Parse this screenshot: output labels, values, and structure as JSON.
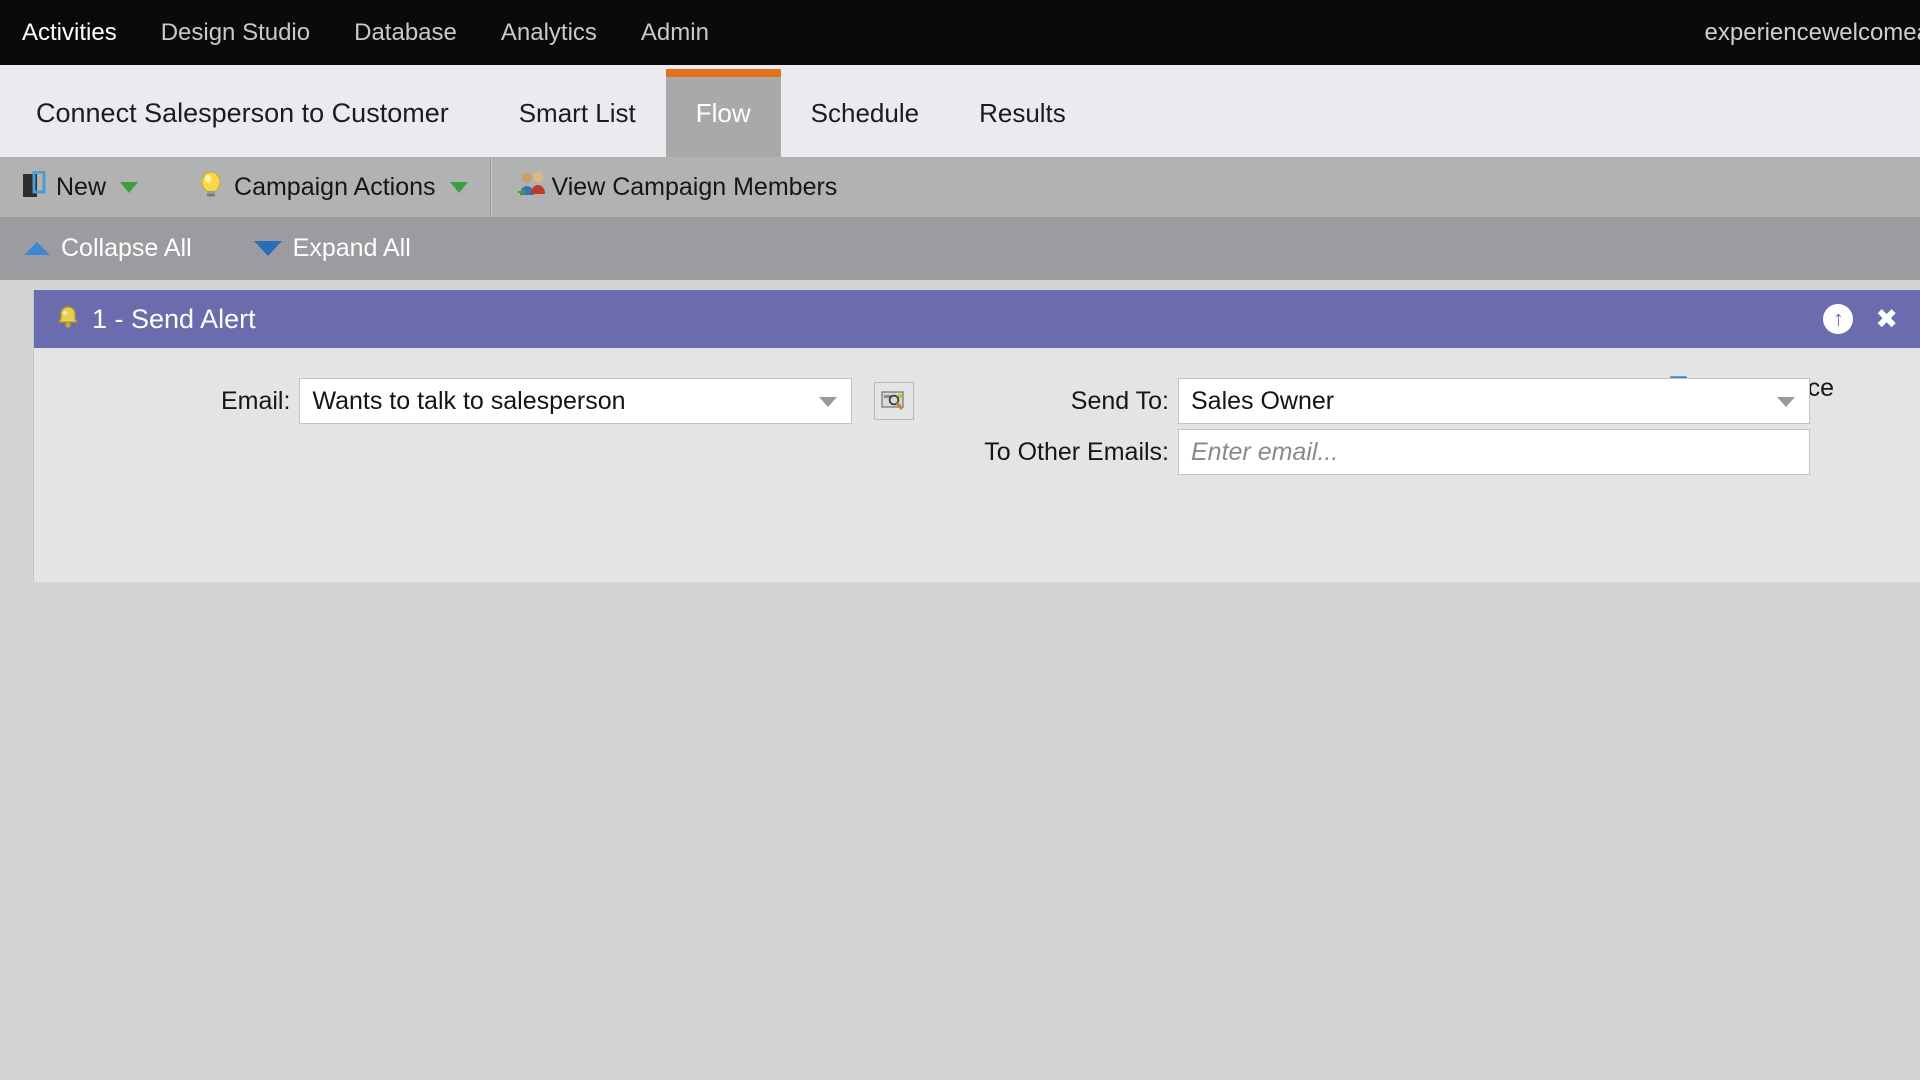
{
  "topnav": {
    "items": [
      {
        "label": "Activities",
        "active": true
      },
      {
        "label": "Design Studio",
        "active": false
      },
      {
        "label": "Database",
        "active": false
      },
      {
        "label": "Analytics",
        "active": false
      },
      {
        "label": "Admin",
        "active": false
      }
    ],
    "user": "experiencewelcomea"
  },
  "tabs": {
    "campaign_title": "Connect Salesperson to Customer",
    "items": [
      {
        "label": "Smart List",
        "active": false
      },
      {
        "label": "Flow",
        "active": true
      },
      {
        "label": "Schedule",
        "active": false
      },
      {
        "label": "Results",
        "active": false
      }
    ],
    "active_accent": "#e3711c"
  },
  "toolbar": {
    "new_label": "New",
    "campaign_actions_label": "Campaign Actions",
    "view_members_label": "View Campaign Members"
  },
  "subtoolbar": {
    "collapse_all": "Collapse All",
    "expand_all": "Expand All"
  },
  "step": {
    "title": "1 - Send Alert",
    "header_color": "#6b6cae",
    "add_choice": "Add Choice",
    "fields": {
      "email_label": "Email:",
      "email_value": "Wants to talk to salesperson",
      "send_to_label": "Send To:",
      "send_to_value": "Sales Owner",
      "other_emails_label": "To Other Emails:",
      "other_emails_value": "",
      "other_emails_placeholder": "Enter email..."
    }
  }
}
